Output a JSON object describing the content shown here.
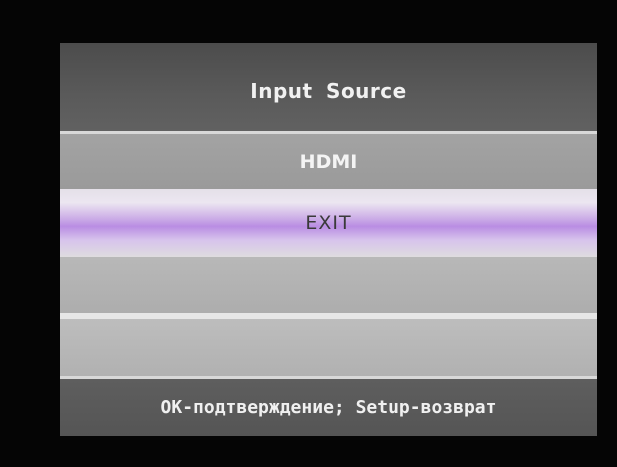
{
  "osd": {
    "title": "Input Source",
    "items": [
      {
        "label": "HDMI",
        "state": "normal"
      },
      {
        "label": "EXIT",
        "state": "highlighted"
      },
      {
        "label": "",
        "state": "empty"
      },
      {
        "label": "",
        "state": "empty"
      }
    ],
    "footer": "OK-подтверждение; Setup-возврат",
    "colors": {
      "background": "#050505",
      "title_bar": "#555555",
      "highlight": "#b98de3",
      "item": "#a3a3a3"
    }
  }
}
